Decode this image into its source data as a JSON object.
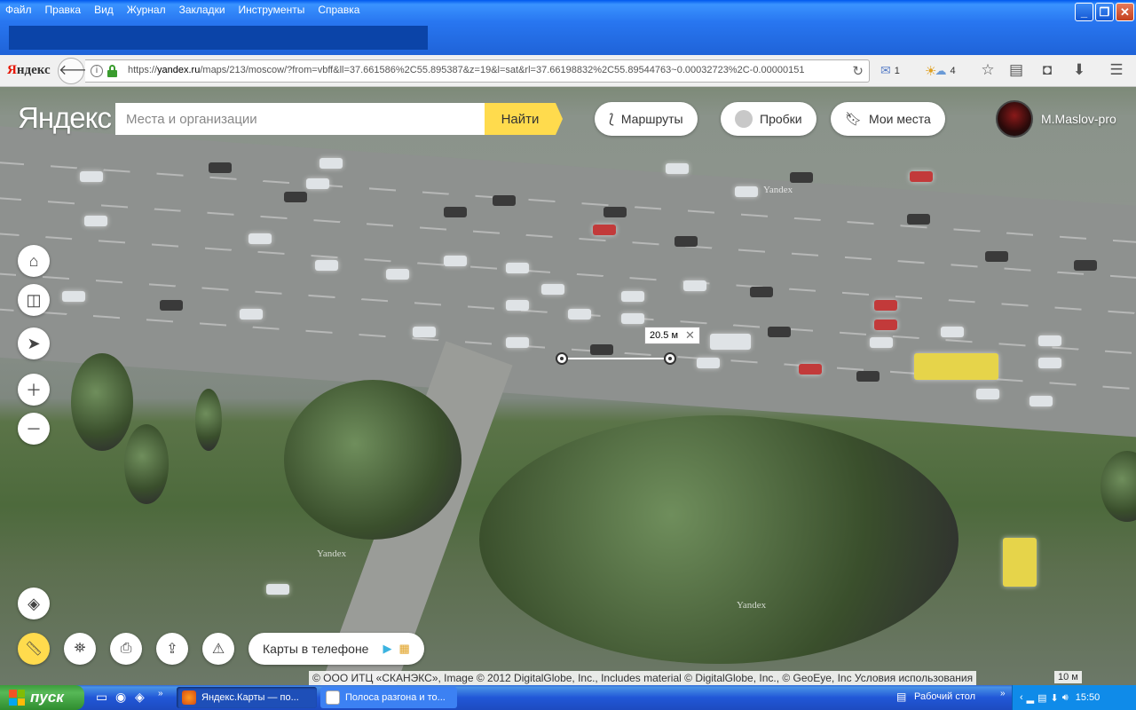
{
  "window": {
    "menu": [
      "Файл",
      "Правка",
      "Вид",
      "Журнал",
      "Закладки",
      "Инструменты",
      "Справка"
    ],
    "controls": {
      "minimize": "_",
      "maximize": "❐",
      "close": "✕"
    }
  },
  "browser": {
    "logo": "Яндекс",
    "url_prefix": "https://",
    "url_host": "yandex.ru",
    "url_path": "/maps/213/moscow/?from=vbff&ll=37.661586%2C55.895387&z=19&l=sat&rl=37.66198832%2C55.89544763~0.00032723%2C-0.00000151",
    "mail_count": "1",
    "weather_temp": "4"
  },
  "map": {
    "logo": "Яндекс",
    "search_placeholder": "Места и организации",
    "search_button": "Найти",
    "routes_label": "Маршруты",
    "traffic_label": "Пробки",
    "myplaces_label": "Мои места",
    "username": "M.Maslov-pro",
    "measure_value": "20.5 м",
    "phone_label": "Карты в телефоне",
    "watermark": "Yandex",
    "copyright": "© ООО ИТЦ «СКАНЭКС», Image © 2012 DigitalGlobe, Inc., Includes material © DigitalGlobe, Inc., © GeoEye, Inc",
    "terms_link": "Условия использования",
    "scale_label": "10 м"
  },
  "taskbar": {
    "start_label": "пуск",
    "tasks": [
      {
        "label": "Яндекс.Карты — по...",
        "active": true
      },
      {
        "label": "Полоса разгона и то...",
        "active": false
      }
    ],
    "desktop_label": "Рабочий стол",
    "clock": "15:50"
  },
  "colors": {
    "accent_yellow": "#ffdb4d",
    "xp_blue": "#2457d6",
    "start_green": "#3c9c3c"
  }
}
